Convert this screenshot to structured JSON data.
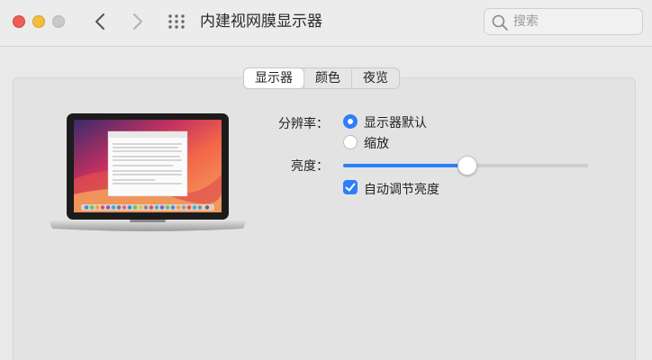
{
  "window": {
    "title": "内建视网膜显示器"
  },
  "search": {
    "placeholder": "搜索",
    "value": ""
  },
  "tabs": [
    {
      "label": "显示器",
      "active": true
    },
    {
      "label": "颜色",
      "active": false
    },
    {
      "label": "夜览",
      "active": false
    }
  ],
  "settings": {
    "resolution_label": "分辨率：",
    "resolution_options": [
      {
        "label": "显示器默认",
        "selected": true
      },
      {
        "label": "缩放",
        "selected": false
      }
    ],
    "brightness_label": "亮度：",
    "brightness_value": 0.5,
    "auto_brightness_label": "自动调节亮度",
    "auto_brightness_checked": true
  },
  "colors": {
    "accent": "#2d7ff9",
    "close": "#ee5d55",
    "minimize": "#f4bd3f"
  }
}
